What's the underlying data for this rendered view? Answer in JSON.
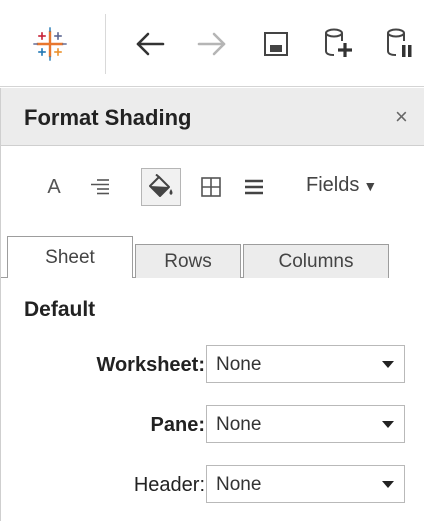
{
  "toolbar": {
    "icons": [
      "tableau-logo-icon",
      "back-arrow-icon",
      "forward-arrow-icon",
      "save-icon",
      "new-data-source-icon",
      "pause-updates-icon"
    ],
    "colors": {
      "logo_blue": "#1f77b4",
      "logo_orange": "#e8762d",
      "logo_red": "#c72035",
      "logo_teal": "#5b6591",
      "arrow_dark": "#333333",
      "arrow_disabled": "#b5b5b5"
    }
  },
  "panel": {
    "title": "Format Shading",
    "close_label": "×",
    "format_tools": {
      "font_label": "A",
      "fields_label": "Fields",
      "fields_caret": "▼"
    },
    "tabs": [
      {
        "label": "Sheet",
        "active": true
      },
      {
        "label": "Rows",
        "active": false
      },
      {
        "label": "Columns",
        "active": false
      }
    ],
    "section_title": "Default",
    "fields": [
      {
        "label": "Worksheet:",
        "value": "None",
        "bold": true
      },
      {
        "label": "Pane:",
        "value": "None",
        "bold": true
      },
      {
        "label": "Header:",
        "value": "None",
        "bold": false
      }
    ]
  }
}
